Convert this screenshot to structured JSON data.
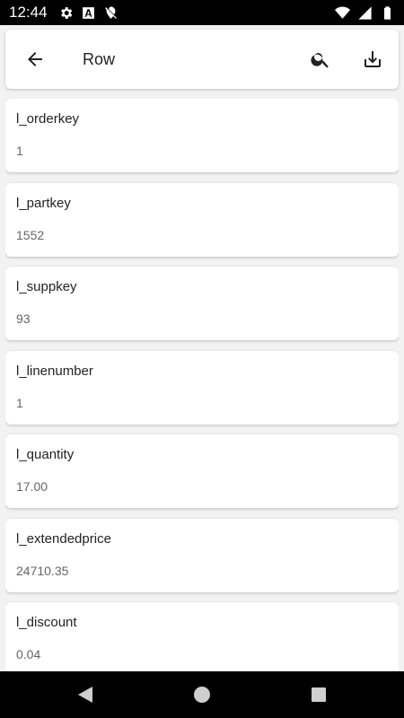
{
  "status_bar": {
    "time": "12:44",
    "left_icons": [
      "gear-icon",
      "font-a-icon",
      "no-location-icon"
    ],
    "right_icons": [
      "wifi-icon",
      "cellular-icon",
      "battery-icon"
    ]
  },
  "header": {
    "title": "Row",
    "back_icon": "arrow-left-icon",
    "search_icon": "search-icon",
    "download_icon": "download-icon"
  },
  "fields": [
    {
      "label": "l_orderkey",
      "value": "1"
    },
    {
      "label": "l_partkey",
      "value": "1552"
    },
    {
      "label": "l_suppkey",
      "value": "93"
    },
    {
      "label": "l_linenumber",
      "value": "1"
    },
    {
      "label": "l_quantity",
      "value": "17.00"
    },
    {
      "label": "l_extendedprice",
      "value": "24710.35"
    },
    {
      "label": "l_discount",
      "value": "0.04"
    }
  ],
  "nav_bar": {
    "back_icon": "triangle-back-icon",
    "home_icon": "circle-home-icon",
    "recents_icon": "square-recents-icon"
  }
}
